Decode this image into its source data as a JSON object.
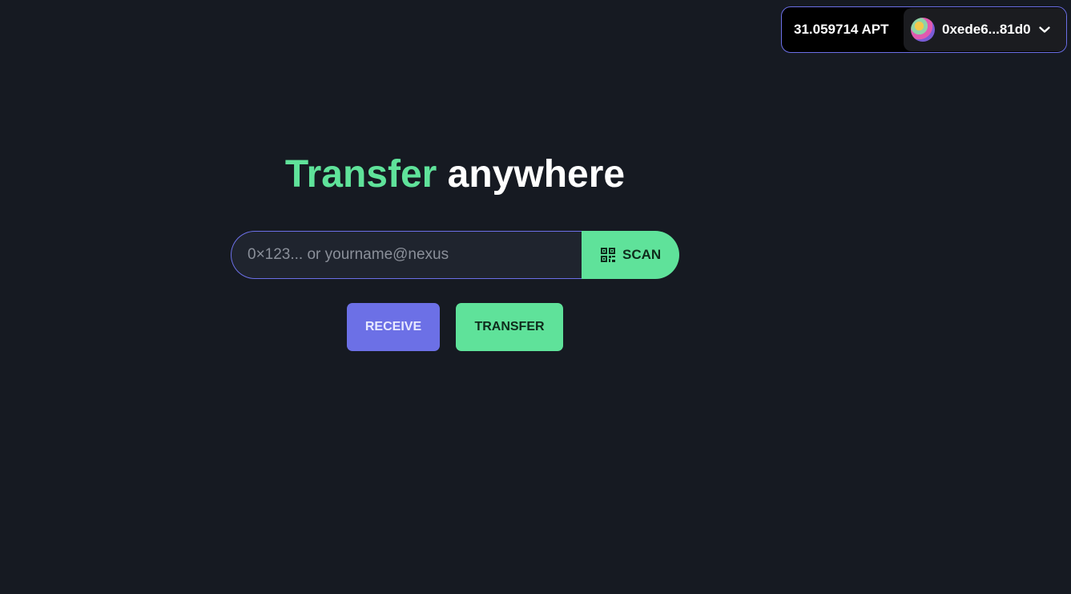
{
  "wallet": {
    "balance": "31.059714 APT",
    "address": "0xede6...81d0",
    "avatar_icon": "avatar",
    "dropdown_icon": "chevron-down-icon"
  },
  "headline": {
    "accent": "Transfer",
    "rest": "anywhere"
  },
  "search": {
    "placeholder": "0×123... or yourname@nexus",
    "value": "",
    "scan_label": "SCAN",
    "scan_icon": "qr-code-icon"
  },
  "actions": {
    "receive_label": "RECEIVE",
    "transfer_label": "TRANSFER"
  },
  "colors": {
    "background": "#161a22",
    "accent_green": "#5fe29a",
    "accent_purple": "#6c70e6"
  }
}
